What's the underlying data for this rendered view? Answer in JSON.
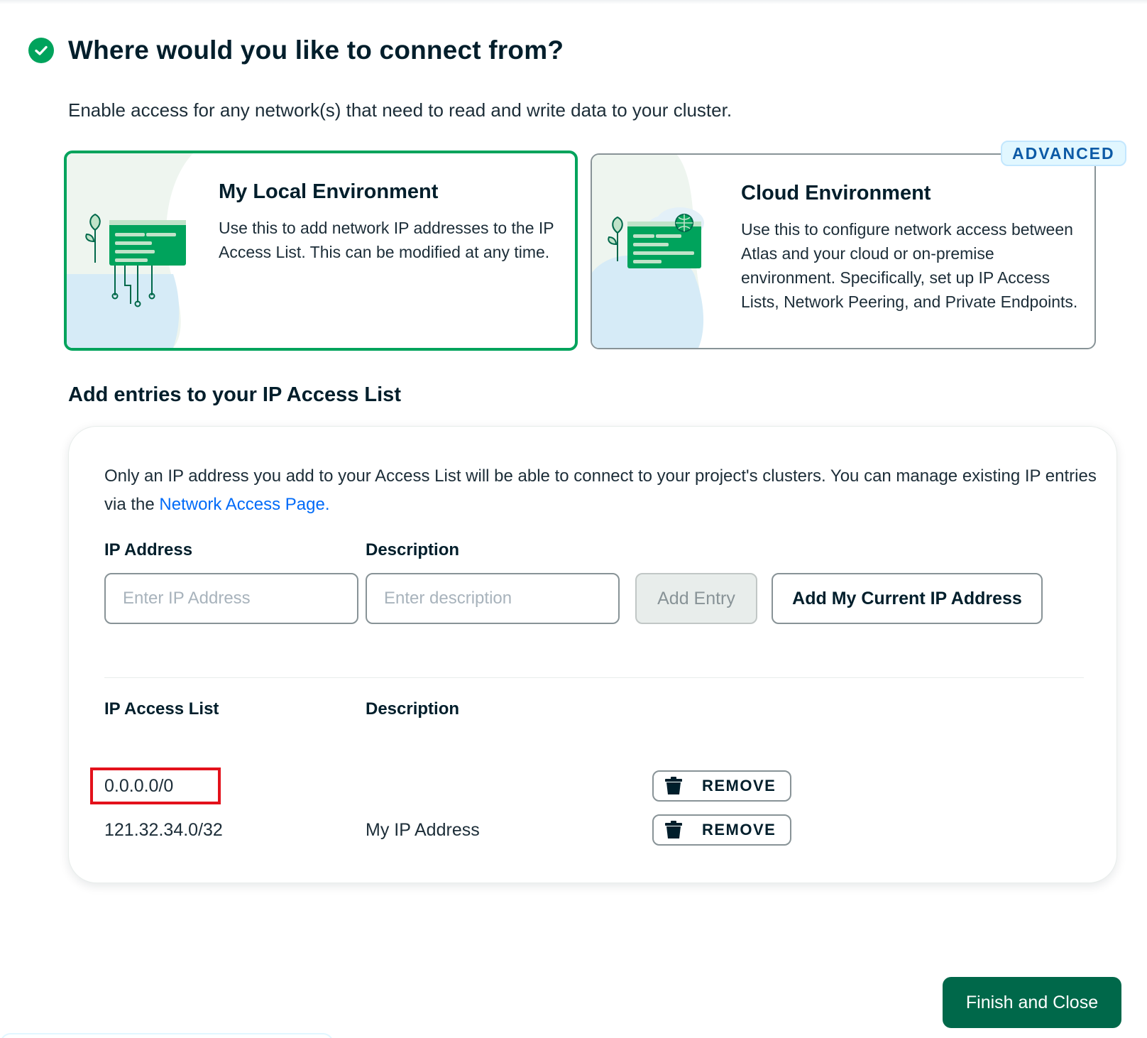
{
  "header": {
    "title": "Where would you like to connect from?",
    "subtitle": "Enable access for any network(s) that need to read and write data to your cluster."
  },
  "options": {
    "local": {
      "title": "My Local Environment",
      "description": "Use this to add network IP addresses to the IP Access List. This can be modified at any time.",
      "selected": true
    },
    "cloud": {
      "badge": "ADVANCED",
      "title": "Cloud Environment",
      "description": "Use this to configure network access between Atlas and your cloud or on-premise environment. Specifically, set up IP Access Lists, Network Peering, and Private Endpoints.",
      "selected": false
    }
  },
  "access_list": {
    "section_title": "Add entries to your IP Access List",
    "info_text": "Only an IP address you add to your Access List will be able to connect to your project's clusters. You can manage existing IP entries via the ",
    "info_link": "Network Access Page.",
    "form": {
      "ip_label": "IP Address",
      "ip_placeholder": "Enter IP Address",
      "desc_label": "Description",
      "desc_placeholder": "Enter description",
      "add_entry_label": "Add Entry",
      "add_current_ip_label": "Add My Current IP Address"
    },
    "table": {
      "col_ip": "IP Access List",
      "col_desc": "Description",
      "remove_label": "REMOVE",
      "rows": [
        {
          "ip": "0.0.0.0/0",
          "description": "",
          "highlighted": true
        },
        {
          "ip": "121.32.34.0/32",
          "description": "My IP Address",
          "highlighted": false
        }
      ]
    }
  },
  "footer": {
    "finish_label": "Finish and Close"
  },
  "colors": {
    "brand_green": "#00a35c",
    "dark_green": "#00684a",
    "link_blue": "#016bf8",
    "highlight_red": "#e3111b"
  }
}
